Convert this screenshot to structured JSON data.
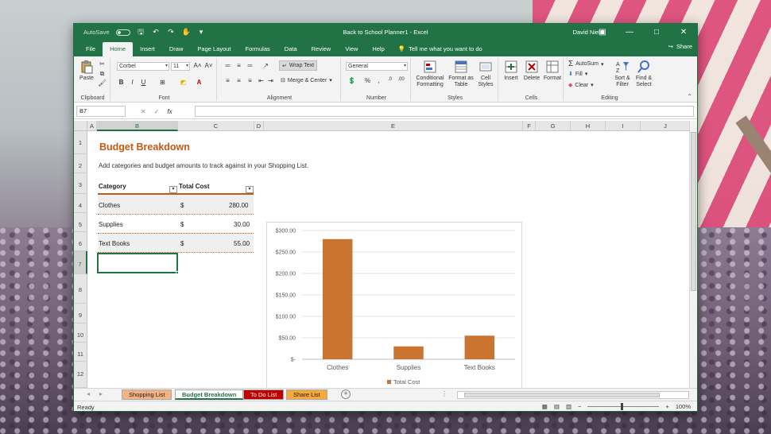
{
  "titlebar": {
    "autosave_label": "AutoSave",
    "autosave_state": "Off",
    "title": "Back to School Planner1  -  Excel",
    "user": "David Nield"
  },
  "tabs": [
    "File",
    "Home",
    "Insert",
    "Draw",
    "Page Layout",
    "Formulas",
    "Data",
    "Review",
    "View",
    "Help"
  ],
  "active_tab": "Home",
  "tell_me": "Tell me what you want to do",
  "share": "Share",
  "ribbon": {
    "clipboard": {
      "label": "Clipboard",
      "paste": "Paste"
    },
    "font": {
      "label": "Font",
      "font_name": "Corbel",
      "font_size": "11"
    },
    "alignment": {
      "label": "Alignment",
      "wrap_text": "Wrap Text",
      "merge_center": "Merge & Center"
    },
    "number": {
      "label": "Number",
      "format": "General"
    },
    "styles": {
      "label": "Styles",
      "conditional": "Conditional Formatting",
      "format_table": "Format as Table",
      "cell_styles": "Cell Styles"
    },
    "cells": {
      "label": "Cells",
      "insert": "Insert",
      "delete": "Delete",
      "format": "Format"
    },
    "editing": {
      "label": "Editing",
      "autosum": "AutoSum",
      "fill": "Fill",
      "clear": "Clear",
      "sort_filter": "Sort & Filter",
      "find_select": "Find & Select"
    }
  },
  "formula_bar": {
    "name_box": "B7",
    "fx": "fx",
    "formula": ""
  },
  "columns": [
    "A",
    "B",
    "C",
    "D",
    "E",
    "F",
    "G",
    "H",
    "I",
    "J"
  ],
  "selected_column": "B",
  "rows": [
    "1",
    "2",
    "3",
    "4",
    "5",
    "6",
    "7",
    "8",
    "9",
    "10",
    "11",
    "12"
  ],
  "selected_row": "7",
  "sheet": {
    "title": "Budget Breakdown",
    "subtitle": "Add categories and budget amounts to track against in your Shopping List.",
    "headers": {
      "category": "Category",
      "total": "Total Cost"
    },
    "table": [
      {
        "category": "Clothes",
        "currency": "$",
        "amount": "280.00"
      },
      {
        "category": "Supplies",
        "currency": "$",
        "amount": "30.00"
      },
      {
        "category": "Text Books",
        "currency": "$",
        "amount": "55.00"
      }
    ]
  },
  "chart_data": {
    "type": "bar",
    "categories": [
      "Clothes",
      "Supplies",
      "Text Books"
    ],
    "series": [
      {
        "name": "Total Cost",
        "values": [
          280,
          30,
          55
        ],
        "color": "#c97431"
      }
    ],
    "ylim": [
      0,
      300
    ],
    "yticks": [
      "$-",
      "$50.00",
      "$100.00",
      "$150.00",
      "$200.00",
      "$250.00",
      "$300.00"
    ],
    "grid": true,
    "legend": "bottom"
  },
  "sheet_tabs": [
    {
      "label": "Shopping List",
      "color": "#f4b183",
      "text": "#222"
    },
    {
      "label": "Budget Breakdown",
      "color": "#ffffff",
      "text": "#217346",
      "active": true
    },
    {
      "label": "To Do List",
      "color": "#c00000",
      "text": "#ffffff"
    },
    {
      "label": "Share List",
      "color": "#f7a83a",
      "text": "#222"
    }
  ],
  "status": {
    "ready": "Ready",
    "zoom": "100%"
  },
  "colors": {
    "excel_green": "#217346",
    "accent_orange": "#c55a11"
  }
}
